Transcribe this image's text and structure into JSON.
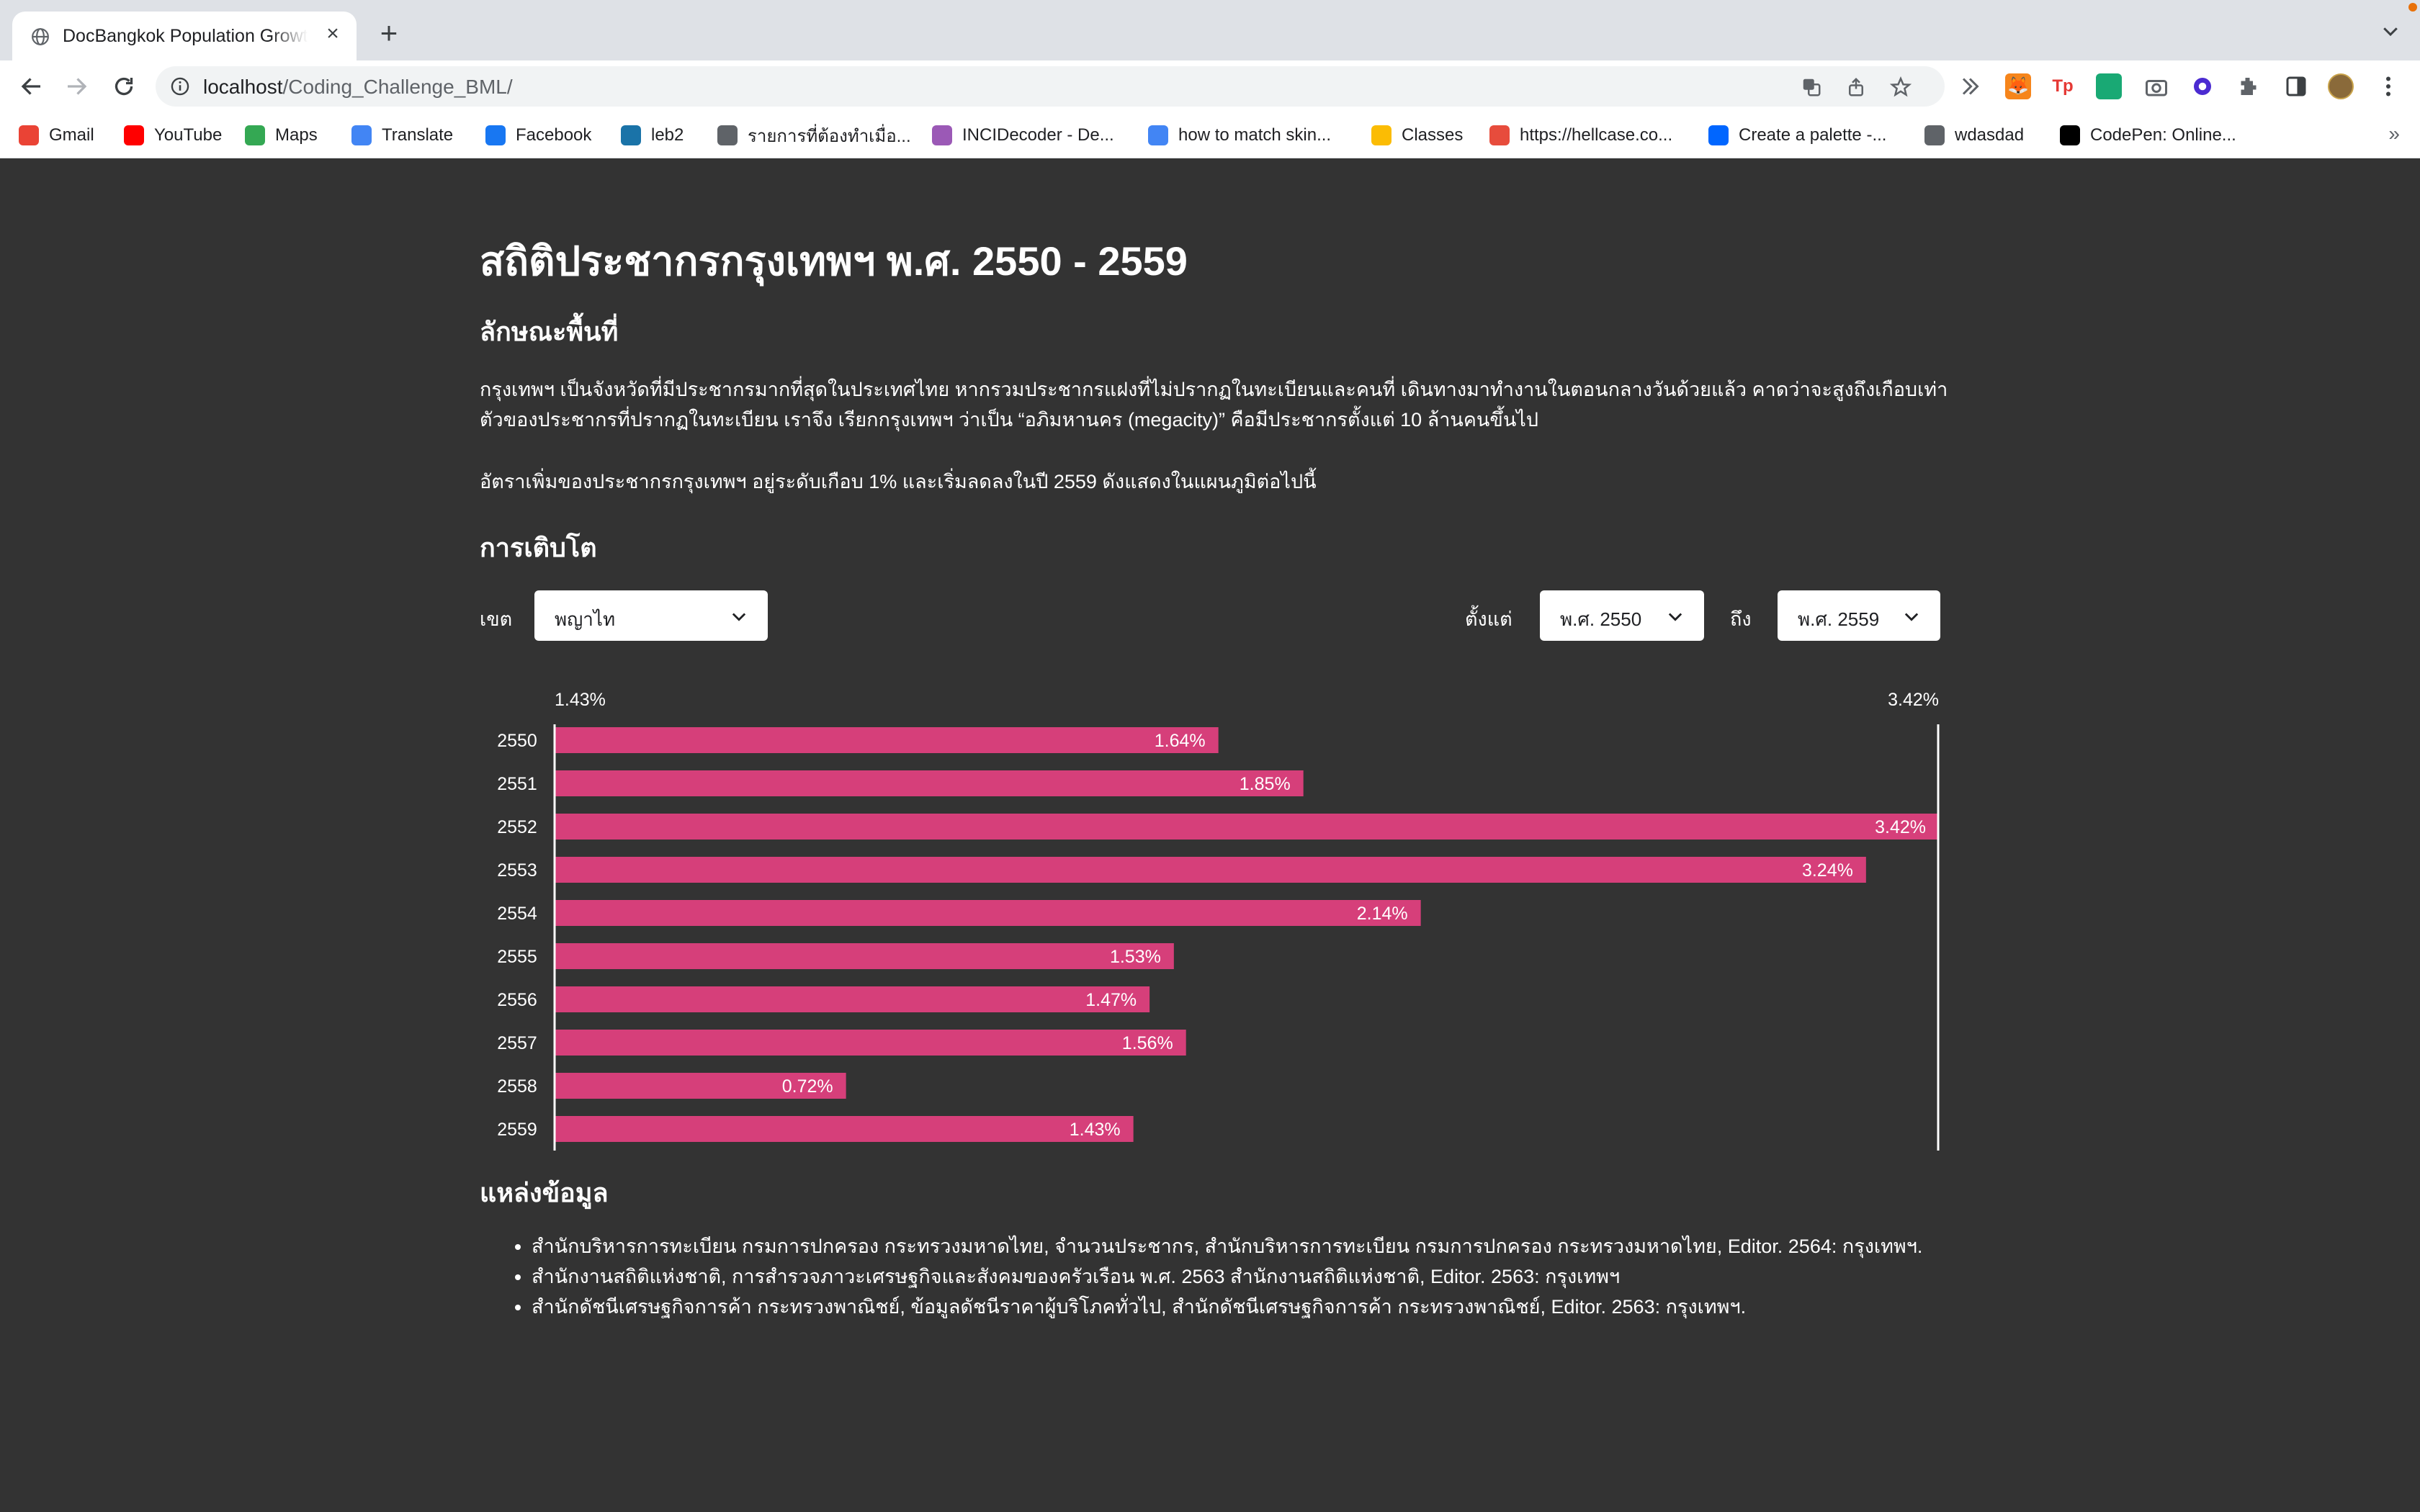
{
  "browser": {
    "tab_title": "DocBangkok Population Growth",
    "url_host": "localhost",
    "url_path": "/Coding_Challenge_BML/",
    "bookmarks": [
      {
        "label": "Gmail",
        "icon": "gmail-icon",
        "color": "#ea4335"
      },
      {
        "label": "YouTube",
        "icon": "youtube-icon",
        "color": "#ff0000"
      },
      {
        "label": "Maps",
        "icon": "maps-icon",
        "color": "#34a853"
      },
      {
        "label": "Translate",
        "icon": "translate-icon",
        "color": "#4285f4"
      },
      {
        "label": "Facebook",
        "icon": "facebook-icon",
        "color": "#1877f2"
      },
      {
        "label": "leb2",
        "icon": "leb2-icon",
        "color": "#1a73a8"
      },
      {
        "label": "รายการที่ต้องทำเมื่อ...",
        "icon": "globe-icon",
        "color": "#5f6368"
      },
      {
        "label": "INCIDecoder - De...",
        "icon": "incidecoder-icon",
        "color": "#9b59b6"
      },
      {
        "label": "how to match skin...",
        "icon": "google-icon",
        "color": "#4285f4"
      },
      {
        "label": "Classes",
        "icon": "classroom-icon",
        "color": "#fbbc04"
      },
      {
        "label": "https://hellcase.co...",
        "icon": "hellcase-icon",
        "color": "#e74c3c"
      },
      {
        "label": "Create a palette -...",
        "icon": "coolors-icon",
        "color": "#0066ff"
      },
      {
        "label": "wdasdad",
        "icon": "globe-icon",
        "color": "#5f6368"
      },
      {
        "label": "CodePen: Online...",
        "icon": "codepen-icon",
        "color": "#000000"
      }
    ]
  },
  "page": {
    "title": "สถิติประชากรกรุงเทพฯ พ.ศ. 2550 - 2559",
    "area_heading": "ลักษณะพื้นที่",
    "paragraph1": "กรุงเทพฯ เป็นจังหวัดที่มีประชากรมากที่สุดในประเทศไทย หากรวมประชากรแฝงที่ไม่ปรากฏในทะเบียนและคนที่ เดินทางมาทำงานในตอนกลางวันด้วยแล้ว คาดว่าจะสูงถึงเกือบเท่าตัวของประชากรที่ปรากฏในทะเบียน เราจึง เรียกกรุงเทพฯ ว่าเป็น “อภิมหานคร (megacity)” คือมีประชากรตั้งแต่ 10 ล้านคนขึ้นไป",
    "paragraph2": "อัตราเพิ่มของประชากรกรุงเทพฯ อยู่ระดับเกือบ 1% และเริ่มลดลงในปี 2559 ดังแสดงในแผนภูมิต่อไปนี้",
    "growth_heading": "การเติบโต",
    "district_label": "เขต",
    "district_value": "พญาไท",
    "from_label": "ตั้งแต่",
    "from_value": "พ.ศ. 2550",
    "to_label": "ถึง",
    "to_value": "พ.ศ. 2559",
    "sources_heading": "แหล่งข้อมูล",
    "sources": [
      "สำนักบริหารการทะเบียน กรมการปกครอง กระทรวงมหาดไทย, จำนวนประชากร, สำนักบริหารการทะเบียน กรมการปกครอง กระทรวงมหาดไทย, Editor. 2564: กรุงเทพฯ.",
      "สำนักงานสถิติแห่งชาติ, การสำรวจภาวะเศรษฐกิจและสังคมของครัวเรือน พ.ศ. 2563 สำนักงานสถิติแห่งชาติ, Editor. 2563: กรุงเทพฯ",
      "สำนักดัชนีเศรษฐกิจการค้า กระทรวงพาณิชย์, ข้อมูลดัชนีราคาผู้บริโภคทั่วไป, สำนักดัชนีเศรษฐกิจการค้า กระทรวงพาณิชย์, Editor. 2563: กรุงเทพฯ."
    ]
  },
  "chart_data": {
    "type": "bar",
    "orientation": "horizontal",
    "categories": [
      "2550",
      "2551",
      "2552",
      "2553",
      "2554",
      "2555",
      "2556",
      "2557",
      "2558",
      "2559"
    ],
    "values": [
      1.64,
      1.85,
      3.42,
      3.24,
      2.14,
      1.53,
      1.47,
      1.56,
      0.72,
      1.43
    ],
    "value_labels": [
      "1.64%",
      "1.85%",
      "3.42%",
      "3.24%",
      "2.14%",
      "1.53%",
      "1.47%",
      "1.56%",
      "0.72%",
      "1.43%"
    ],
    "axis_min_label": "1.43%",
    "axis_max_label": "3.42%",
    "xlim": [
      0,
      3.42
    ],
    "bar_color": "#d63f7a",
    "grid": false
  },
  "colors": {
    "background": "#333333",
    "text": "#ffffff",
    "bar": "#d63f7a"
  }
}
